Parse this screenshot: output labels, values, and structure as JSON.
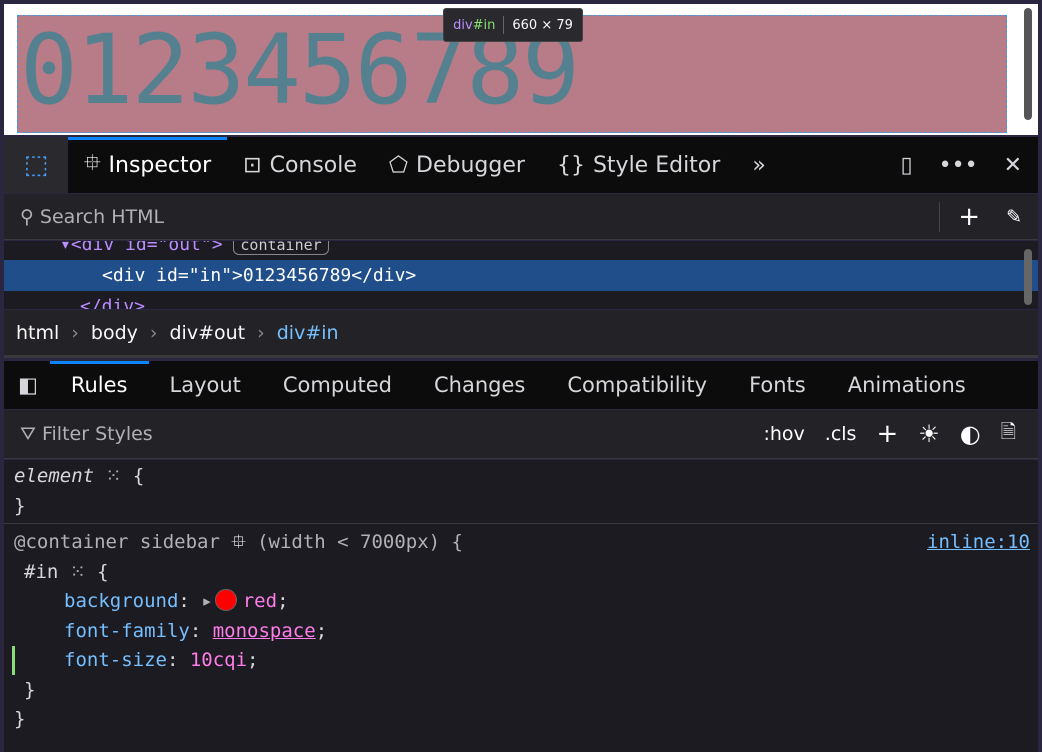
{
  "page": {
    "content": "0123456789"
  },
  "tooltip": {
    "tag": "div",
    "id": "#in",
    "size": "660 × 79"
  },
  "toolbar": {
    "tabs": [
      {
        "label": "Inspector"
      },
      {
        "label": "Console"
      },
      {
        "label": "Debugger"
      },
      {
        "label": "Style Editor"
      }
    ]
  },
  "search": {
    "placeholder": "Search HTML"
  },
  "markup": {
    "parent_row": "▾<div id=\"out\">",
    "parent_badge": "container",
    "selected_row": "<div id=\"in\">0123456789</div>",
    "closing_row": "</div>"
  },
  "breadcrumbs": [
    "html",
    "body",
    "div#out",
    "div#in"
  ],
  "sidebar": {
    "tabs": [
      "Rules",
      "Layout",
      "Computed",
      "Changes",
      "Compatibility",
      "Fonts",
      "Animations"
    ]
  },
  "filter": {
    "placeholder": "Filter Styles",
    "hov": ":hov",
    "cls": ".cls"
  },
  "rules": {
    "element": "element",
    "container_rule": "@container sidebar",
    "container_query": "(width < 7000px) {",
    "source": "inline:10",
    "selector": "#in",
    "declarations": [
      {
        "prop": "background",
        "value": "red"
      },
      {
        "prop": "font-family",
        "value": "monospace"
      },
      {
        "prop": "font-size",
        "value": "10cqi"
      }
    ]
  },
  "colors": {
    "swatch": "#ff0000",
    "accent": "#0a84ff"
  }
}
